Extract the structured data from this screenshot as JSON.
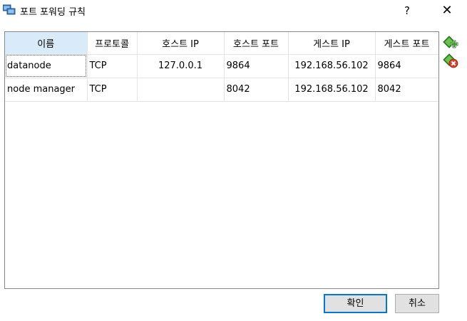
{
  "window": {
    "title": "포트 포워딩 규칙",
    "help_label": "?",
    "close_label": "✕",
    "icon": "virtualbox-network-icon"
  },
  "table": {
    "columns": [
      "이름",
      "프로토콜",
      "호스트 IP",
      "호스트 포트",
      "게스트 IP",
      "게스트 포트"
    ],
    "rows": [
      [
        "datanode",
        "TCP",
        "127.0.0.1",
        "9864",
        "192.168.56.102",
        "9864"
      ],
      [
        "node manager",
        "TCP",
        "",
        "8042",
        "192.168.56.102",
        "8042"
      ]
    ]
  },
  "side_buttons": {
    "add_icon": "add-rule-icon",
    "remove_icon": "remove-rule-icon"
  },
  "buttons": {
    "ok_label": "확인",
    "cancel_label": "취소"
  },
  "colors": {
    "accent": "#0078d7",
    "header_selected": "#d9ebf9",
    "add_green": "#3a9a2a",
    "remove_red": "#d9412b"
  }
}
